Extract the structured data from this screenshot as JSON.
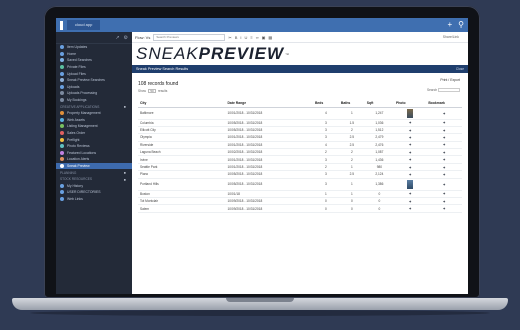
{
  "topbar": {
    "app_tab": "cloud app",
    "plus_icon": "plus",
    "search_icon": "search"
  },
  "sidebar": {
    "items": [
      {
        "label": "Item Updates",
        "icon_color": "#6aa0e0"
      },
      {
        "label": "Home",
        "icon_color": "#6aa0e0"
      },
      {
        "label": "Saved Searches",
        "icon_color": "#7fb3e6"
      },
      {
        "label": "Private Files",
        "icon_color": "#5bc0a0"
      },
      {
        "label": "Upload Files",
        "icon_color": "#6aa0e0"
      },
      {
        "label": "Sneak Preview Searches",
        "icon_color": "#8fb0d8"
      },
      {
        "label": "Uploads",
        "icon_color": "#6aa0e0"
      },
      {
        "label": "Uploads Processing",
        "icon_color": "#7c8aa0"
      },
      {
        "label": "My Bookings",
        "icon_color": "#7c8aa0"
      }
    ],
    "section_label": "CREATIVE APPLICATIONS",
    "apps": [
      {
        "label": "Property Management",
        "icon_color": "#e0903a"
      },
      {
        "label": "Web Assets",
        "icon_color": "#5ab0e0"
      },
      {
        "label": "Listing Management",
        "icon_color": "#78c060"
      },
      {
        "label": "Sales Order",
        "icon_color": "#e06060"
      },
      {
        "label": "Preflight",
        "icon_color": "#f0c040"
      },
      {
        "label": "Photo Reviews",
        "icon_color": "#60c0c0"
      },
      {
        "label": "Featured Locations",
        "icon_color": "#c080e0"
      },
      {
        "label": "Location Alerts",
        "icon_color": "#e09060"
      },
      {
        "label": "Sneak Preview",
        "icon_color": "#ffffff"
      }
    ],
    "lower_sections": [
      {
        "label": "PLANNING"
      },
      {
        "label": "STOCK RESOURCES"
      }
    ],
    "lower_items": [
      {
        "label": "My History"
      },
      {
        "label": "USER DIRECTORIES"
      },
      {
        "label": "Web Links"
      }
    ]
  },
  "toolbar": {
    "view_label": "Flow: Vs",
    "search_placeholder": "Search Previews",
    "share_label": "Share/Link"
  },
  "brand": {
    "thin": "SNEAK",
    "bold": "PREVIEW",
    "tm": "™"
  },
  "titlebar": {
    "title": "Sneak Preview Search Results",
    "close": "Close"
  },
  "results": {
    "count_label": "108 records found",
    "show_label": "Show",
    "show_value": "50",
    "per_page_label": "results",
    "export_label": "Print / Export",
    "search_label": "Search"
  },
  "table": {
    "headers": [
      "City",
      "Date Range",
      "Beds",
      "Baths",
      "Sqft",
      "Photo",
      "Bookmark"
    ],
    "rows": [
      {
        "city": "Baltimore",
        "dates": "10/01/2018 - 10/31/2018",
        "beds": "4",
        "baths": "1",
        "sqft": "1,247",
        "photo": true,
        "photo_style": "warm"
      },
      {
        "city": "Columbia",
        "dates": "10/05/2018 - 10/31/2018",
        "beds": "3",
        "baths": "1.5",
        "sqft": "1,036",
        "photo": false
      },
      {
        "city": "Ellicott City",
        "dates": "10/05/2018 - 10/31/2018",
        "beds": "3",
        "baths": "2",
        "sqft": "1,512",
        "photo": false
      },
      {
        "city": "Olympia",
        "dates": "10/01/2018 - 10/31/2018",
        "beds": "3",
        "baths": "2.5",
        "sqft": "2,479",
        "photo": false
      },
      {
        "city": "Riverside",
        "dates": "10/01/2018 - 10/31/2018",
        "beds": "4",
        "baths": "2.5",
        "sqft": "2,476",
        "photo": false
      },
      {
        "city": "Laguna Beach",
        "dates": "10/02/2018 - 10/31/2018",
        "beds": "2",
        "baths": "2",
        "sqft": "1,087",
        "photo": false
      },
      {
        "city": "Irvine",
        "dates": "10/01/2018 - 10/31/2018",
        "beds": "3",
        "baths": "2",
        "sqft": "1,436",
        "photo": false
      },
      {
        "city": "Seattle Park",
        "dates": "10/01/2018 - 10/31/2018",
        "beds": "2",
        "baths": "1",
        "sqft": "980",
        "photo": false
      },
      {
        "city": "Plano",
        "dates": "10/05/2018 - 10/31/2018",
        "beds": "3",
        "baths": "2.5",
        "sqft": "2,124",
        "photo": false
      },
      {
        "city": "Portland Hills",
        "dates": "10/05/2018 - 10/31/2018",
        "beds": "3",
        "baths": "1",
        "sqft": "1,386",
        "photo": true,
        "photo_style": "blue"
      },
      {
        "city": "Boston",
        "dates": "10/01/18",
        "beds": "1",
        "baths": "1",
        "sqft": "0",
        "photo": false
      },
      {
        "city": "Tot Montclair",
        "dates": "10/09/2018 - 10/31/2018",
        "beds": "0",
        "baths": "0",
        "sqft": "0",
        "photo": false
      },
      {
        "city": "Salem",
        "dates": "10/09/2018 - 10/31/2018",
        "beds": "0",
        "baths": "0",
        "sqft": "0",
        "photo": false
      }
    ]
  }
}
